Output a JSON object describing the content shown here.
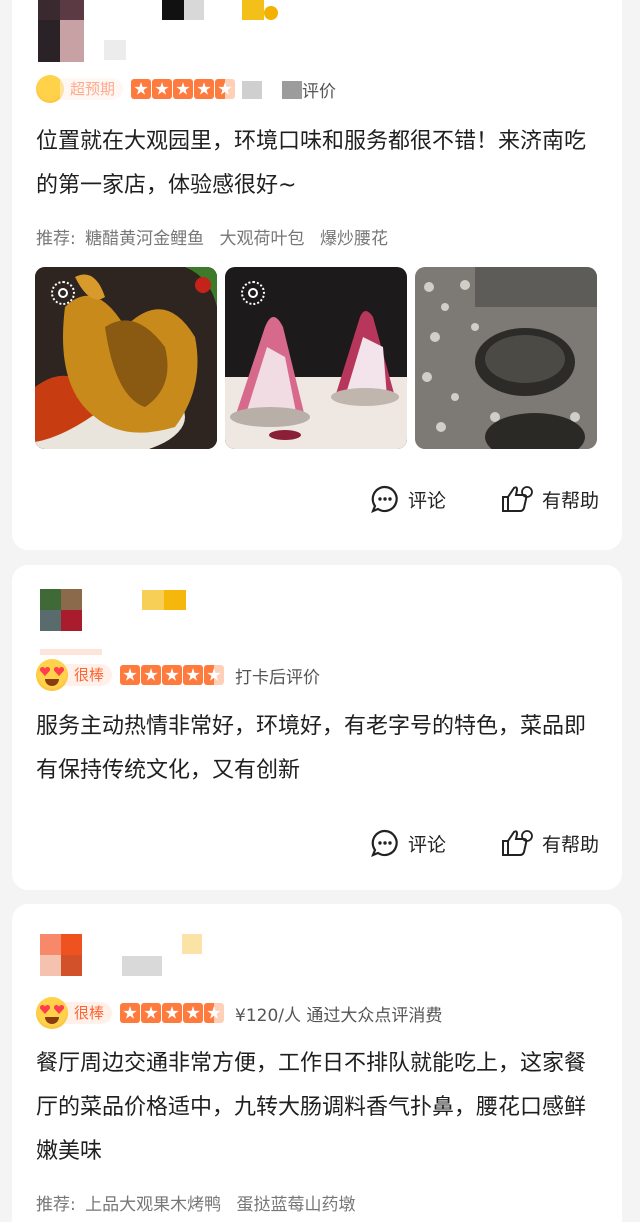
{
  "reviews": [
    {
      "badge": "超预期",
      "meta": "评价",
      "text": "位置就在大观园里，环境口味和服务都很不错！来济南吃的第一家店，体验感很好~",
      "recommend_label": "推荐:",
      "recommend_items": [
        "糖醋黄河金鲤鱼",
        "大观荷叶包",
        "爆炒腰花"
      ],
      "comment_label": "评论",
      "helpful_label": "有帮助"
    },
    {
      "badge": "很棒",
      "meta": "打卡后评价",
      "text": "服务主动热情非常好，环境好，有老字号的特色，菜品即有保持传统文化，又有创新",
      "comment_label": "评论",
      "helpful_label": "有帮助"
    },
    {
      "badge": "很棒",
      "meta": "¥120/人 通过大众点评消费",
      "text": "餐厅周边交通非常方便，工作日不排队就能吃上，这家餐厅的菜品价格适中，九转大肠调料香气扑鼻，腰花口感鲜嫩美味",
      "recommend_label": "推荐:",
      "recommend_items": [
        "上品大观果木烤鸭",
        "蛋挞蓝莓山药墩"
      ]
    }
  ],
  "colors": {
    "accent": "#ff6633",
    "star": "#ff7a3d",
    "page_bg": "#f4f4f4"
  },
  "icons": {
    "comment": "comment-bubble-icon",
    "helpful": "thumbs-up-icon",
    "live": "live-photo-icon"
  }
}
